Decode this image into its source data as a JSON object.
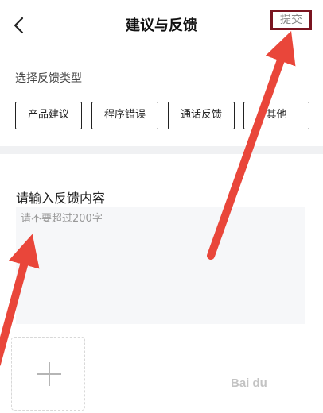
{
  "nav": {
    "title": "建议与反馈",
    "submit_label": "提交",
    "back_icon": "chevron-left-icon"
  },
  "feedback_type": {
    "label": "选择反馈类型",
    "options": [
      "产品建议",
      "程序错误",
      "通话反馈",
      "其他"
    ]
  },
  "content": {
    "label": "请输入反馈内容",
    "placeholder": "请不要超过200字",
    "value": ""
  },
  "upload": {
    "icon": "plus-icon"
  },
  "annotations": {
    "arrow_color": "#e9463a",
    "highlight_color": "#7a1420"
  },
  "watermark": {
    "text": "Bai du"
  }
}
